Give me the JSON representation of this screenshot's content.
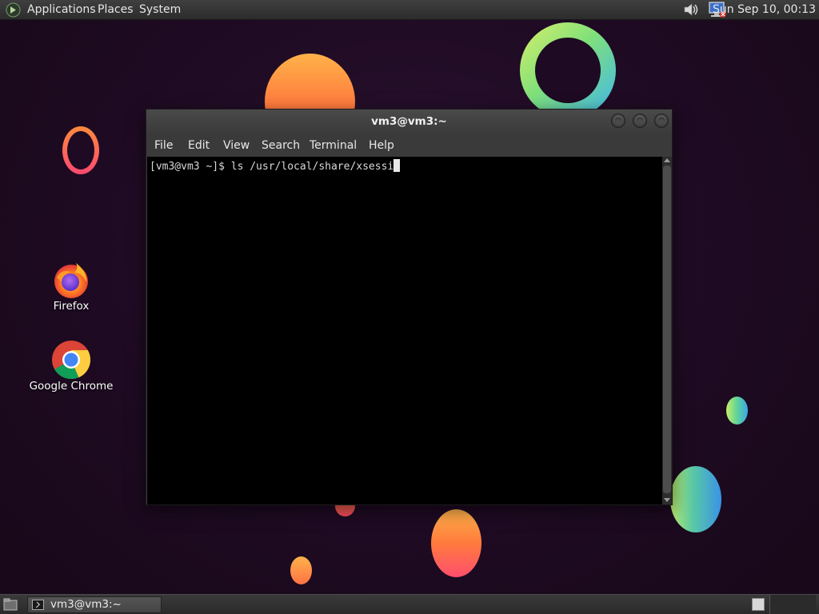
{
  "top_panel": {
    "menus": [
      "Applications",
      "Places",
      "System"
    ],
    "clock": "Sun Sep 10, 00:13",
    "icons": [
      "app-menu-icon",
      "volume-icon",
      "network-icon"
    ]
  },
  "desktop": {
    "icons": [
      {
        "label": "Firefox",
        "icon": "firefox-icon"
      },
      {
        "label": "Google Chrome",
        "icon": "chrome-icon"
      }
    ]
  },
  "terminal": {
    "title": "vm3@vm3:~",
    "menu": [
      "File",
      "Edit",
      "View",
      "Search",
      "Terminal",
      "Help"
    ],
    "prompt": "[vm3@vm3 ~]$ ",
    "command": "ls /usr/local/share/xsessi"
  },
  "bottom_panel": {
    "task_label": "vm3@vm3:~",
    "icons": [
      "show-desktop-icon",
      "terminal-icon",
      "workspace-switcher-icon"
    ]
  },
  "colors": {
    "desktop_bg": "#1e0a22",
    "panel_bg": "#2c2c2c",
    "terminal_bg": "#000000",
    "accent_orange": "#ff7a3d",
    "accent_green": "#7fe07a",
    "accent_blue": "#3fb6f0"
  }
}
